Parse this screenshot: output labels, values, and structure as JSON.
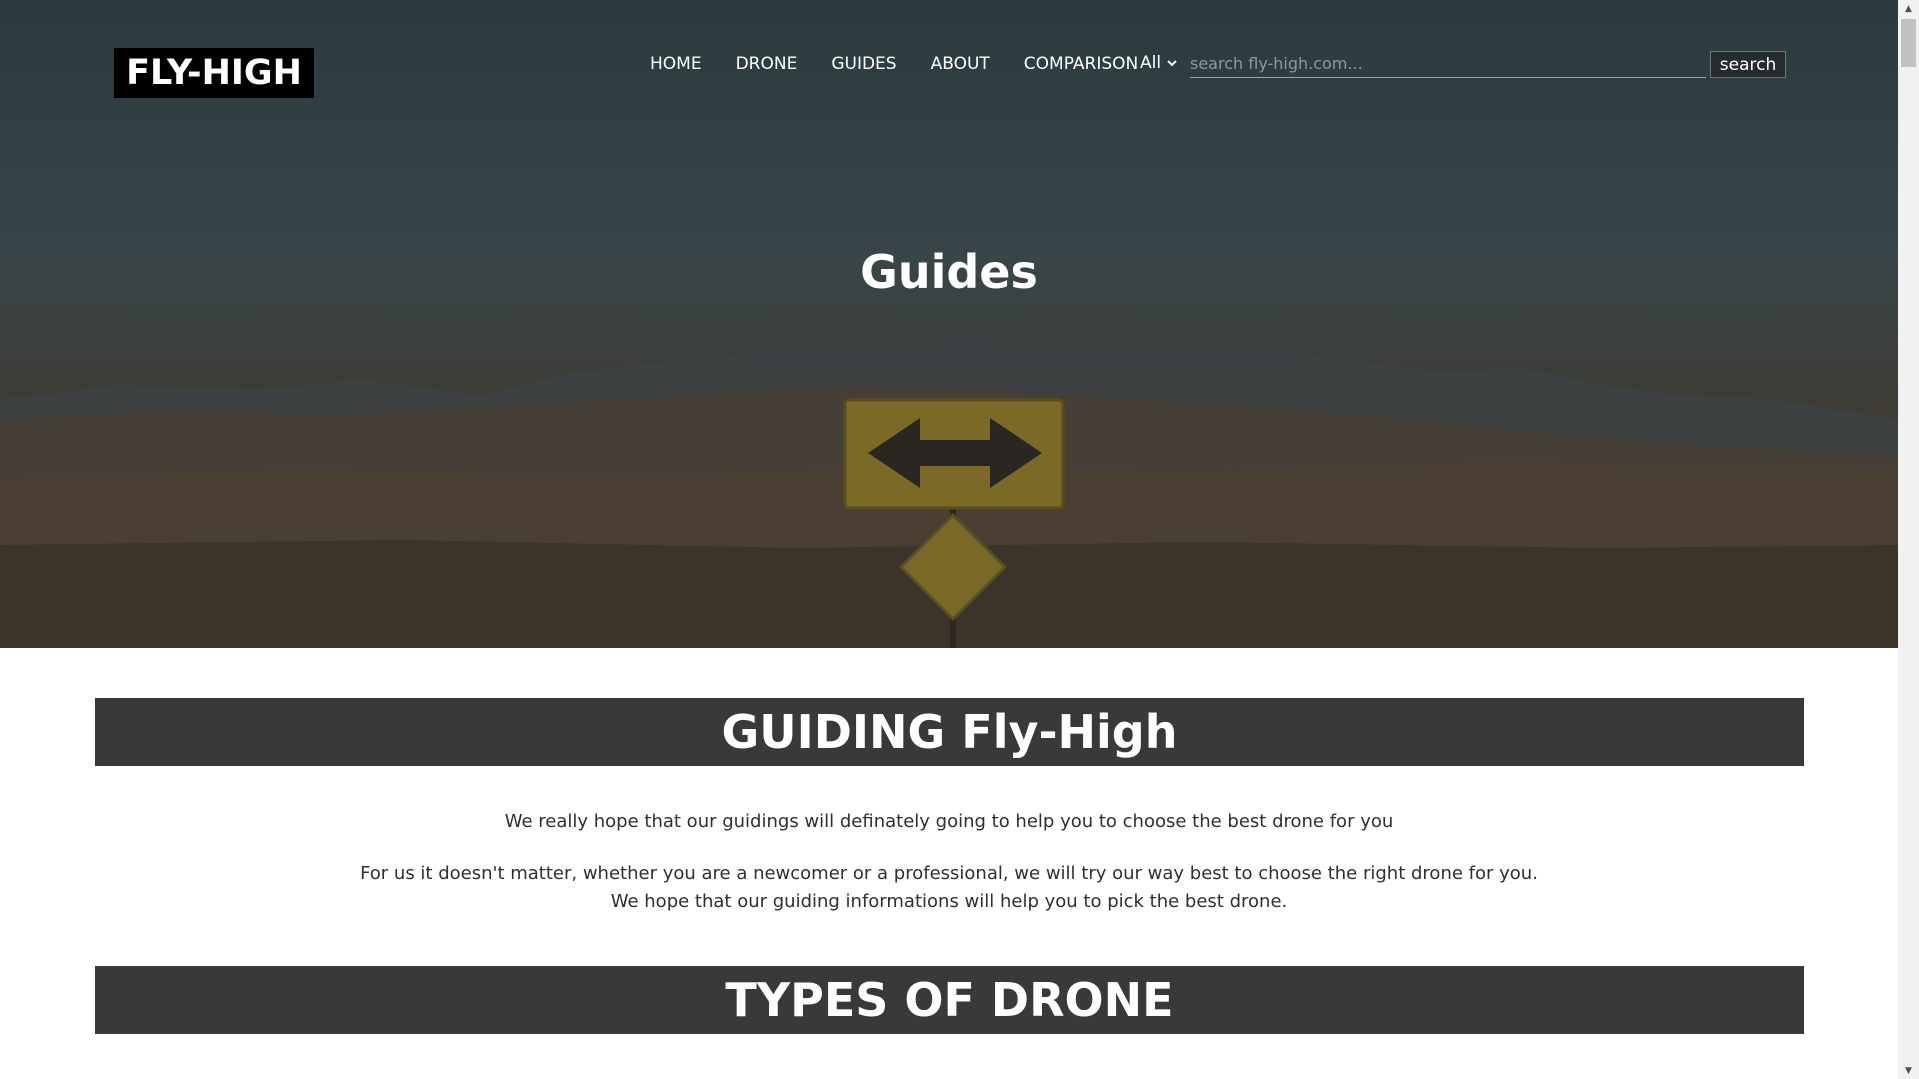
{
  "header": {
    "logo": "FLY-HIGH",
    "nav": [
      "HOME",
      "DRONE",
      "GUIDES",
      "ABOUT",
      "COMPARISON"
    ],
    "search": {
      "scope": "All",
      "placeholder": "search fly-high.com...",
      "button": "search"
    }
  },
  "hero": {
    "title": "Guides"
  },
  "sections": {
    "guiding": {
      "heading": "GUIDING Fly-High",
      "paragraph1": "We really hope that our guidings will definately going to help you to choose the best drone for you",
      "paragraph2_line1": "For us it doesn't matter, whether you are a newcomer or a professional, we will try our way best to choose the right drone for you.",
      "paragraph2_line2": "We hope that our guiding informations will help you to pick the best drone."
    },
    "types": {
      "heading": "TYPES OF DRONE"
    }
  },
  "colors": {
    "band": "#3b3937",
    "logo_bg": "#000000",
    "text": "#2f2f2f"
  }
}
